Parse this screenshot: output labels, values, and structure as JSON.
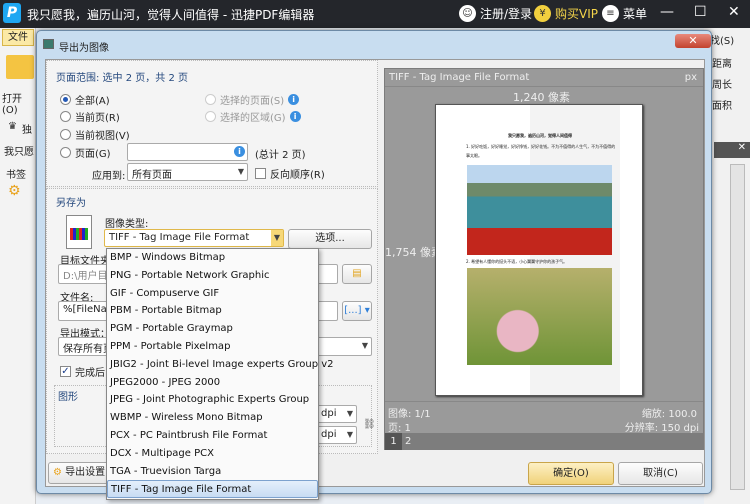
{
  "app": {
    "title": "我只愿我，遍历山河，觉得人间值得 - 迅捷PDF编辑器",
    "logo": "P",
    "login": "注册/登录",
    "vip": "购买VIP",
    "menu": "菜单",
    "login_icon": "user-icon",
    "vip_icon": "yen-icon",
    "menu_icon": "menu-icon"
  },
  "background": {
    "file_tab": "文件",
    "open": "打开(O)",
    "partial1": "独",
    "partial2": "我只愿",
    "bookmarks": "书签",
    "find": "找(S)",
    "distance": "距离",
    "perimeter": "周长",
    "area": "面积"
  },
  "dialog": {
    "title": "导出为图像",
    "range_label": "页面范围: 选中 2 页，共 2 页",
    "radios": {
      "all": "全部(A)",
      "current_page": "当前页(R)",
      "current_view": "当前视图(V)",
      "pages": "页面(G)",
      "selected_pages": "选择的页面(S)",
      "selected_area": "选择的区域(G)"
    },
    "pages_value": "",
    "total": "(总计 2 页)",
    "apply_label": "应用到:",
    "apply_value": "所有页面",
    "reverse": "反向顺序(R)",
    "reverse_checked": false,
    "save_as": "另存为",
    "image_type_label": "图像类型:",
    "image_type_value": "TIFF - Tag Image File Format",
    "options_button": "选项...",
    "folder_label": "目标文件夹",
    "folder_value": "D:\\用户目",
    "filename_label": "文件名:",
    "filename_value": "%[FileNar",
    "filename_macro": "[...]",
    "mode_label": "导出模式：",
    "mode_value": "保存所有页",
    "after_label": "完成后",
    "after_checked": true,
    "graphics_label": "图形",
    "dpi1": "dpi",
    "dpi2": "dpi",
    "export_settings": "导出设置",
    "ok": "确定(O)",
    "cancel": "取消(C)"
  },
  "dropdown": {
    "selected_index": 13,
    "items": [
      "BMP - Windows Bitmap",
      "PNG - Portable Network Graphic",
      "GIF - Compuserve GIF",
      "PBM - Portable Bitmap",
      "PGM - Portable Graymap",
      "PPM - Portable Pixelmap",
      "JBIG2 - Joint Bi-level Image experts Group v2",
      "JPEG2000 - JPEG 2000",
      "JPEG - Joint Photographic Experts Group",
      "WBMP - Wireless Mono Bitmap",
      "PCX - PC Paintbrush File Format",
      "DCX - Multipage PCX",
      "TGA - Truevision Targa",
      "TIFF - Tag Image File Format"
    ]
  },
  "preview": {
    "format": "TIFF - Tag Image File Format",
    "unit": "px",
    "width": "1,240 像素",
    "height": "1,754 像素",
    "image": "图像: 1/1",
    "page": "页: 1",
    "zoom": "缩放: 100.0",
    "resolution": "分辨率: 150 dpi",
    "page_tabs": [
      "1",
      "2"
    ],
    "doc_title": "我只愿我，遍历山河，觉得人间值得",
    "doc_p1": "1. 好好吃饭，好好睡觉，好好挣钱，好好花钱。不为不值得的人生气，不为不值得的事太眼。",
    "doc_p2": "2. 希望有人懂你的挺头不语，小心翼翼守护你的孩子气。"
  }
}
